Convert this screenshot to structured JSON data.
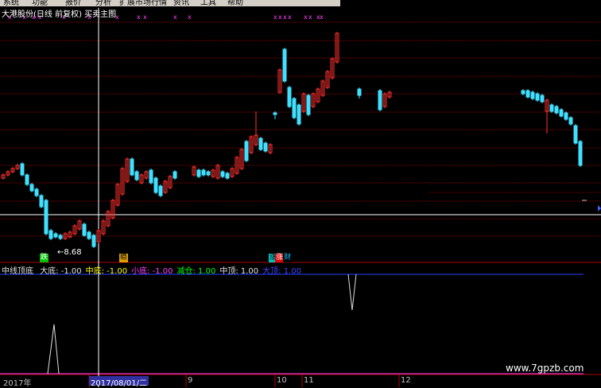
{
  "menu": [
    "系统",
    "功能",
    "报价",
    "分析",
    "扩展市场行情",
    "资讯",
    "工具",
    "帮助"
  ],
  "title": "大港股份(日线 前复权) 买卖主图",
  "low_annotation": "8.68",
  "signals": [
    {
      "text": "跌",
      "bg": "#00c000",
      "color": "#ffffff"
    },
    {
      "text": "稳",
      "bg": "#e0a000",
      "color": "#000000"
    },
    {
      "text": "涨",
      "bg": "#00c0c0",
      "color": "#000000"
    },
    {
      "text": "涨",
      "bg": "#e00000",
      "color": "#ffffff"
    },
    {
      "text": "财",
      "bg": "#000000",
      "color": "#00c0ff"
    }
  ],
  "indicator": {
    "name": "中线顶底",
    "items": [
      {
        "label": "大底:",
        "value": "-1.00",
        "color": "#e0e0e0"
      },
      {
        "label": "中底:",
        "value": "-1.00",
        "color": "#ffff00"
      },
      {
        "label": "小底:",
        "value": "-1.00",
        "color": "#ff40ff"
      },
      {
        "label": "减仓:",
        "value": "1.00",
        "color": "#00ff00"
      },
      {
        "label": "中顶:",
        "value": "1.00",
        "color": "#e0e0e0"
      },
      {
        "label": "大顶:",
        "value": "1.00",
        "color": "#4040ff"
      }
    ]
  },
  "dates": {
    "year": "2017年",
    "selected": "2017/08/01/二",
    "months": [
      "9",
      "10",
      "11",
      "12"
    ]
  },
  "watermark": "www.7gpzb.com",
  "colors": {
    "up": "#ff3030",
    "down": "#40e0ff",
    "grid": "#8b0000",
    "crosshair": "#ffffff"
  }
}
